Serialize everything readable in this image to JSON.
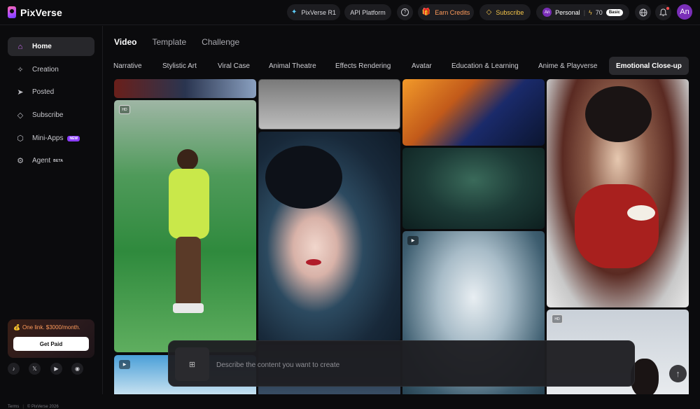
{
  "app": {
    "name": "PixVerse"
  },
  "header": {
    "pixverse_r1": "PixVerse R1",
    "api_platform": "API Platform",
    "earn_credits": "Earn Credits",
    "subscribe": "Subscribe",
    "account_initials": "An",
    "account_name": "Personal",
    "credits": "70",
    "plan": "Basic",
    "avatar_initials": "An",
    "help_icon": "question-icon",
    "globe_icon": "globe-icon",
    "bell_icon": "bell-icon",
    "notification_dot_color": "#ff4d4f",
    "accent_color": "#7a2fb8",
    "credits_color": "#f4c44a",
    "subscribe_color": "#f4c44a",
    "earn_credits_color": "#ff9b5b"
  },
  "sidebar": {
    "items": [
      {
        "label": "Home",
        "icon": "home-icon",
        "active": true
      },
      {
        "label": "Creation",
        "icon": "sparkle-icon"
      },
      {
        "label": "Posted",
        "icon": "send-icon"
      },
      {
        "label": "Subscribe",
        "icon": "diamond-icon"
      },
      {
        "label": "Mini-Apps",
        "icon": "cube-icon",
        "badge": "NEW"
      },
      {
        "label": "Agent",
        "icon": "agent-icon",
        "badge": "BETA"
      }
    ],
    "promo": {
      "text": "One link. $3000/month.",
      "button": "Get Paid"
    },
    "social": [
      "tiktok-icon",
      "x-icon",
      "youtube-icon",
      "discord-icon"
    ],
    "footer": {
      "terms": "Terms",
      "copyright": "© PixVerse 2026"
    }
  },
  "main": {
    "tabs": [
      {
        "label": "Video",
        "active": true
      },
      {
        "label": "Template"
      },
      {
        "label": "Challenge"
      }
    ],
    "categories": [
      "Narrative",
      "Stylistic Art",
      "Viral Case",
      "Animal Theatre",
      "Effects Rendering",
      "Avatar",
      "Education & Learning",
      "Anime & Playverse",
      "Emotional Close-up"
    ],
    "active_category": "Emotional Close-up",
    "prompt": {
      "placeholder": "Describe the content you want to create"
    },
    "badge_hd": "HD"
  }
}
